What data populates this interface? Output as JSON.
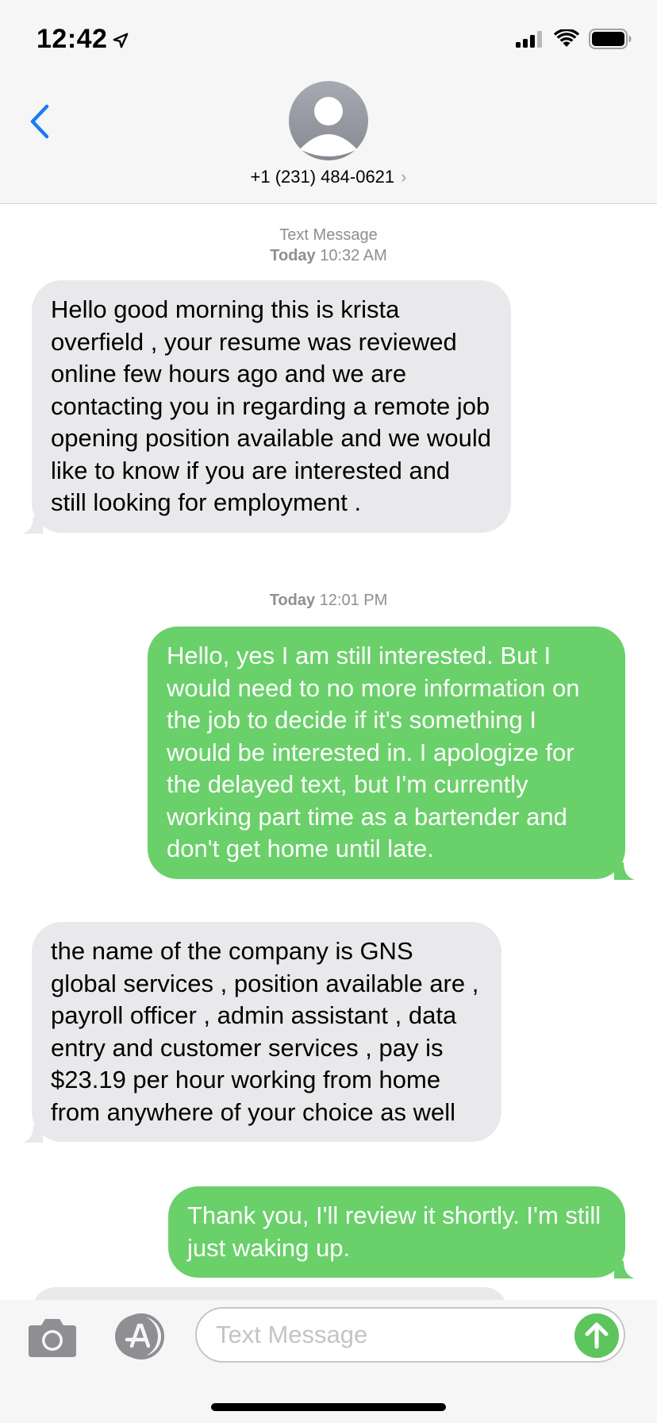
{
  "status": {
    "time": "12:42",
    "icons": [
      "location-arrow-icon",
      "cellular-signal-icon",
      "wifi-icon",
      "battery-icon"
    ]
  },
  "header": {
    "contact": "+1 (231) 484-0621",
    "chevron": "›"
  },
  "messages": [
    {
      "type": "meta",
      "line1": "Text Message",
      "line2_day": "Today",
      "line2_time": "10:32 AM"
    },
    {
      "type": "incoming",
      "text": "Hello good morning this is krista overfield , your resume was reviewed online few hours ago and we are contacting you in regarding a remote job opening position available and we would like to know if you are interested and still looking for employment ."
    },
    {
      "type": "meta",
      "line2_day": "Today",
      "line2_time": "12:01 PM"
    },
    {
      "type": "outgoing",
      "text": "Hello, yes I am still interested. But I would need to no more information on the job to decide if it's something I would be interested in. I apologize for the delayed text, but I'm currently working part time as a bartender and don't get home until late."
    },
    {
      "type": "incoming",
      "text": "the name of the company is GNS global services , position available are , payroll officer , admin assistant , data entry and customer services , pay is $23.19 per hour working from home from anywhere of your choice as well"
    },
    {
      "type": "outgoing",
      "text": "Thank you, I'll review it shortly. I'm still just waking up."
    }
  ],
  "composer": {
    "placeholder": "Text Message"
  },
  "colors": {
    "outgoing_bubble": "#6ad06a",
    "incoming_bubble": "#e9e9eb",
    "accent": "#1a7cf5"
  }
}
